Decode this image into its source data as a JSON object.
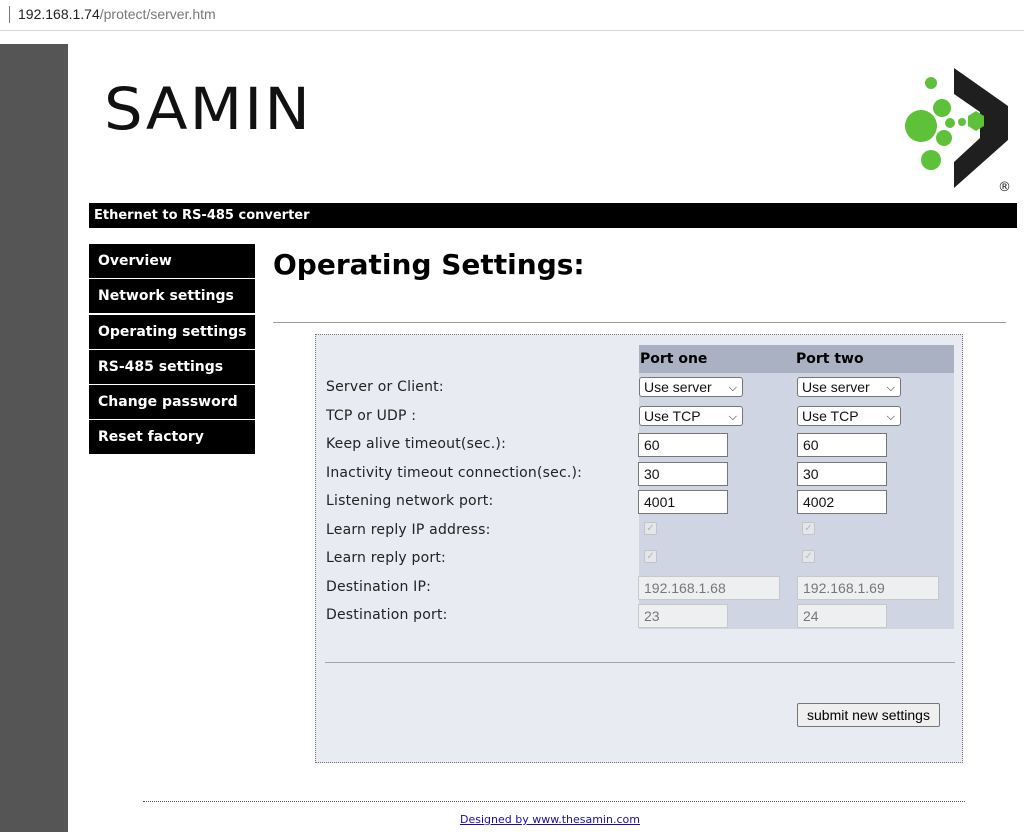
{
  "browser": {
    "url_host": "192.168.1.74",
    "url_path": "/protect/server.htm"
  },
  "header": {
    "logo_text": "SAMIN",
    "registered_mark": "®",
    "title_bar": "Ethernet to RS-485 converter"
  },
  "sidebar": {
    "items": [
      {
        "label": "Overview"
      },
      {
        "label": "Network settings"
      },
      {
        "label": "Operating settings"
      },
      {
        "label": "RS-485 settings"
      },
      {
        "label": "Change password"
      },
      {
        "label": "Reset factory"
      }
    ]
  },
  "main": {
    "title": "Operating Settings:",
    "columns": [
      "Port one",
      "Port two"
    ],
    "rows": {
      "server_or_client": {
        "label": "Server or Client:",
        "port_one": "Use server",
        "port_two": "Use server"
      },
      "tcp_or_udp": {
        "label": "TCP or UDP :",
        "port_one": "Use TCP",
        "port_two": "Use TCP"
      },
      "keep_alive": {
        "label": "Keep alive timeout(sec.):",
        "port_one": "60",
        "port_two": "60"
      },
      "inactivity": {
        "label": "Inactivity timeout connection(sec.):",
        "port_one": "30",
        "port_two": "30"
      },
      "listening_port": {
        "label": "Listening network port:",
        "port_one": "4001",
        "port_two": "4002"
      },
      "learn_ip": {
        "label": "Learn reply IP address:",
        "port_one_checked": true,
        "port_two_checked": true
      },
      "learn_port": {
        "label": "Learn reply port:",
        "port_one_checked": true,
        "port_two_checked": true
      },
      "destination_ip": {
        "label": "Destination IP:",
        "port_one": "192.168.1.68",
        "port_two": "192.168.1.69"
      },
      "destination_port": {
        "label": "Destination port:",
        "port_one": "23",
        "port_two": "24"
      }
    },
    "submit_label": "submit new settings"
  },
  "footer": {
    "link_text": "Designed by www.thesamin.com"
  },
  "colors": {
    "brand_green": "#5dc23a",
    "panel_bg": "#e8ebf2",
    "column_bg": "#cfd5e2",
    "column_header_bg": "#a9b1c2"
  }
}
